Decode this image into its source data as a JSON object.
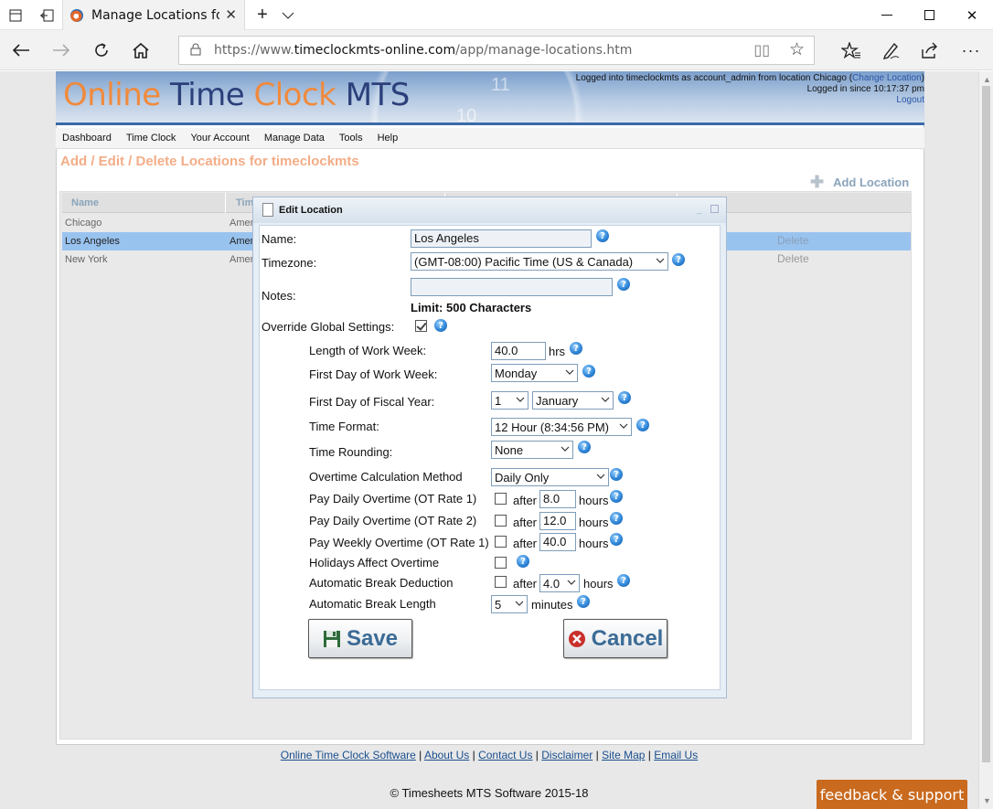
{
  "browser": {
    "tab_title": "Manage Locations for ti",
    "url_prefix": "https://www.",
    "url_host": "timeclockmts-online.com",
    "url_path": "/app/manage-locations.htm"
  },
  "header": {
    "logo_part1": "Online ",
    "logo_part2": "Time ",
    "logo_part3": "Clock ",
    "logo_part4": "MTS",
    "clock_numbers": [
      "11",
      "10"
    ],
    "login_text": "Logged into timeclockmts as account_admin from location Chicago (",
    "change_location": "Change Location",
    "login_close": ")",
    "logged_in_since": "Logged in since 10:17:37 pm",
    "logout": "Logout"
  },
  "menu": [
    "Dashboard",
    "Time Clock",
    "Your Account",
    "Manage Data",
    "Tools",
    "Help"
  ],
  "page": {
    "heading": "Add / Edit / Delete Locations for timeclockmts",
    "add_location": "Add Location"
  },
  "list": {
    "col_name": "Name",
    "col_tz": "Tim",
    "rows": [
      {
        "name": "Chicago",
        "tz": "Amer",
        "delete": ""
      },
      {
        "name": "Los Angeles",
        "tz": "Amer",
        "delete": "Delete"
      },
      {
        "name": "New York",
        "tz": "Amer",
        "delete": "Delete"
      }
    ]
  },
  "dialog": {
    "title": "Edit Location",
    "name_label": "Name:",
    "name_value": "Los Angeles",
    "timezone_label": "Timezone:",
    "timezone_value": "(GMT-08:00) Pacific Time (US & Canada)",
    "notes_label": "Notes:",
    "notes_value": "",
    "limit_text": "Limit: 500 Characters",
    "override_label": "Override Global Settings:",
    "work_week_label": "Length of Work Week:",
    "work_week_value": "40.0",
    "hrs": "hrs",
    "first_day_week_label": "First Day of Work Week:",
    "first_day_week_value": "Monday",
    "fiscal_label": "First Day of Fiscal Year:",
    "fiscal_day": "1",
    "fiscal_month": "January",
    "time_format_label": "Time Format:",
    "time_format_value": "12 Hour (8:34:56 PM)",
    "rounding_label": "Time Rounding:",
    "rounding_value": "None",
    "ot_method_label": "Overtime Calculation Method",
    "ot_method_value": "Daily Only",
    "daily_ot1_label": "Pay Daily Overtime (OT Rate 1)",
    "daily_ot1_value": "8.0",
    "daily_ot2_label": "Pay Daily Overtime (OT Rate 2)",
    "daily_ot2_value": "12.0",
    "weekly_ot_label": "Pay Weekly Overtime (OT Rate 1)",
    "weekly_ot_value": "40.0",
    "holidays_label": "Holidays Affect Overtime",
    "break_deduction_label": "Automatic Break Deduction",
    "break_deduction_value": "4.0",
    "break_length_label": "Automatic Break Length",
    "break_length_value": "5",
    "after": "after",
    "hours": "hours",
    "minutes": "minutes",
    "help_glyph": "?",
    "save": "Save",
    "cancel": "Cancel"
  },
  "footer": {
    "links": [
      "Online Time Clock Software",
      "About Us",
      "Contact Us",
      "Disclaimer",
      "Site Map",
      "Email Us"
    ],
    "copyright": "© Timesheets MTS Software 2015-18",
    "feedback": "feedback & support"
  },
  "colors": {
    "accent_orange": "#f08a3c",
    "heading_salmon": "#f3ad87",
    "selected_row": "#99c3ef",
    "feedback_bg": "#c96a1f"
  }
}
